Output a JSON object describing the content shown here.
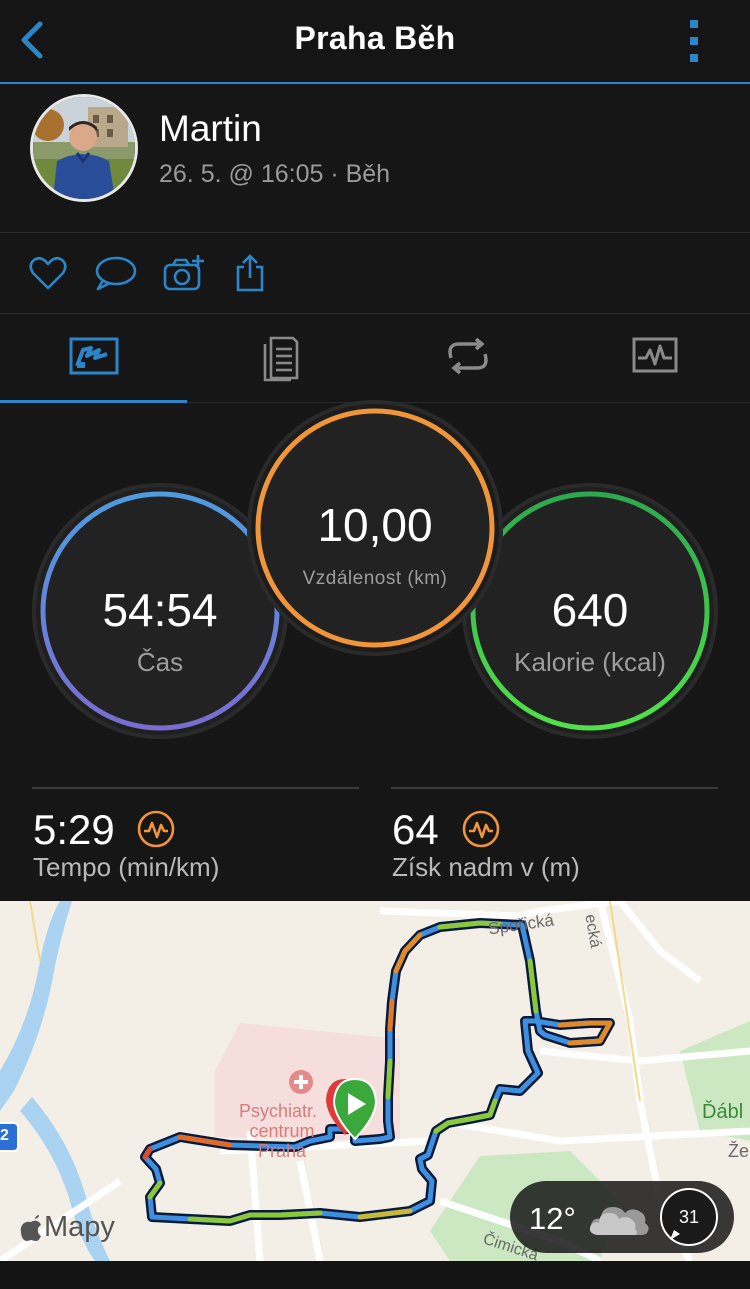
{
  "header": {
    "title": "Praha Běh",
    "back_icon": "chevron-left-icon",
    "more_icon": "vertical-dots-icon"
  },
  "profile": {
    "name": "Martin",
    "meta": "26. 5. @ 16:05 · Běh"
  },
  "actions": [
    "heart-icon",
    "comment-icon",
    "camera-add-icon",
    "share-icon"
  ],
  "tabs": [
    "overview",
    "details",
    "laps",
    "charts"
  ],
  "rings": {
    "time": {
      "value": "54:54",
      "label": "Čas",
      "color": "#6b85e0"
    },
    "distance": {
      "value": "10,00",
      "label": "Vzdálenost (km)",
      "color": "#f0953a"
    },
    "calories": {
      "value": "640",
      "label": "Kalorie (kcal)",
      "color": "#3fbf5a"
    }
  },
  "stats": {
    "pace": {
      "value": "5:29",
      "label": "Tempo (min/km)"
    },
    "elevation": {
      "value": "64",
      "label": "Získ nadm v (m)"
    }
  },
  "map": {
    "labels": {
      "street1": "Spořická",
      "street2": "ecká",
      "place": "Psychiatr. centrum Praha",
      "place_l1": "Psychiatr.",
      "place_l2": "centrum",
      "place_l3": "Praha",
      "area": "Ďábl",
      "area2": "Že",
      "road": "Čimická",
      "badge": "2"
    },
    "brand": "Mapy",
    "weather": {
      "temp": "12°",
      "wind": "31",
      "icon": "cloud-icon"
    }
  },
  "colors": {
    "accent": "#2b86c9",
    "icon_orange": "#f0953a"
  }
}
